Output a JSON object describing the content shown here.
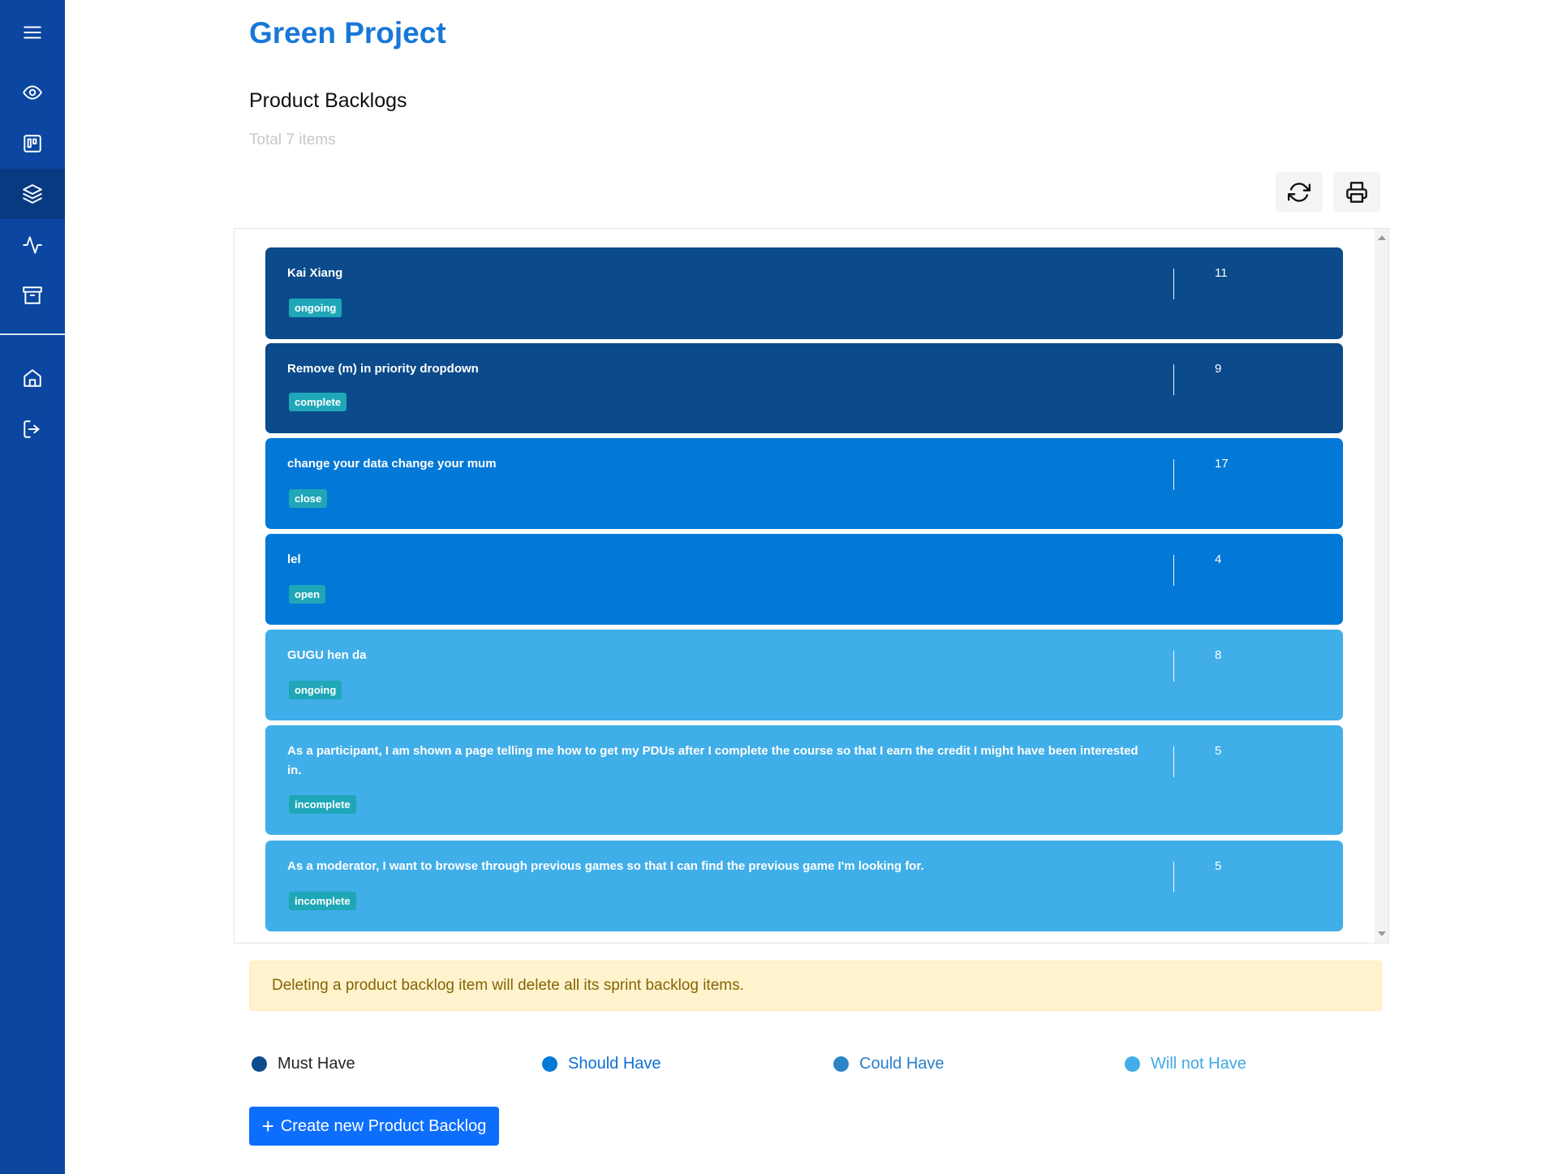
{
  "project": {
    "title": "Green Project"
  },
  "page": {
    "section_title": "Product Backlogs",
    "total_text": "Total 7 items"
  },
  "toolbar": {
    "refresh_icon": "refresh-icon",
    "print_icon": "print-icon"
  },
  "sidebar": {
    "menu_icon": "hamburger-menu-icon",
    "items": [
      {
        "name": "overview",
        "icon": "eye-icon",
        "active": false
      },
      {
        "name": "board",
        "icon": "kanban-icon",
        "active": false
      },
      {
        "name": "backlogs",
        "icon": "layers-icon",
        "active": true
      },
      {
        "name": "activity",
        "icon": "activity-icon",
        "active": false
      },
      {
        "name": "archive",
        "icon": "archive-icon",
        "active": false
      },
      {
        "name": "home",
        "icon": "home-icon",
        "active": false
      },
      {
        "name": "logout",
        "icon": "logout-icon",
        "active": false
      }
    ]
  },
  "backlog_items": [
    {
      "title": "Kai Xiang",
      "status": "ongoing",
      "points": "11",
      "priority": "Must Have"
    },
    {
      "title": "Remove (m) in priority dropdown",
      "status": "complete",
      "points": "9",
      "priority": "Must Have"
    },
    {
      "title": "change your data change your mum",
      "status": "close",
      "points": "17",
      "priority": "Should Have"
    },
    {
      "title": "lel",
      "status": "open",
      "points": "4",
      "priority": "Should Have"
    },
    {
      "title": "GUGU hen da",
      "status": "ongoing",
      "points": "8",
      "priority": "Will not Have"
    },
    {
      "title": "As a participant, I am shown a page telling me how to get my PDUs after I complete the course so that I earn the credit I might have been interested in.",
      "status": "incomplete",
      "points": "5",
      "priority": "Will not Have"
    },
    {
      "title": "As a moderator, I want to browse through previous games so that I can find the previous game I'm looking for.",
      "status": "incomplete",
      "points": "5",
      "priority": "Will not Have"
    }
  ],
  "warning": {
    "text": "Deleting a product backlog item will delete all its sprint backlog items."
  },
  "legend": [
    {
      "label": "Must Have",
      "color": "#0b4a8b",
      "text_color": "#212529"
    },
    {
      "label": "Should Have",
      "color": "#0278d7",
      "text_color": "#0d6fd3"
    },
    {
      "label": "Could Have",
      "color": "#2c85c9",
      "text_color": "#2880c8"
    },
    {
      "label": "Will not Have",
      "color": "#40aee8",
      "text_color": "#3fa8e4"
    }
  ],
  "create_button": {
    "label": "Create new Product Backlog"
  },
  "colors": {
    "must": "#0b4a8b",
    "should": "#0278d7",
    "will_not": "#40aee8",
    "badge": "#1fa7b8",
    "sidebar": "#0b46a0"
  }
}
